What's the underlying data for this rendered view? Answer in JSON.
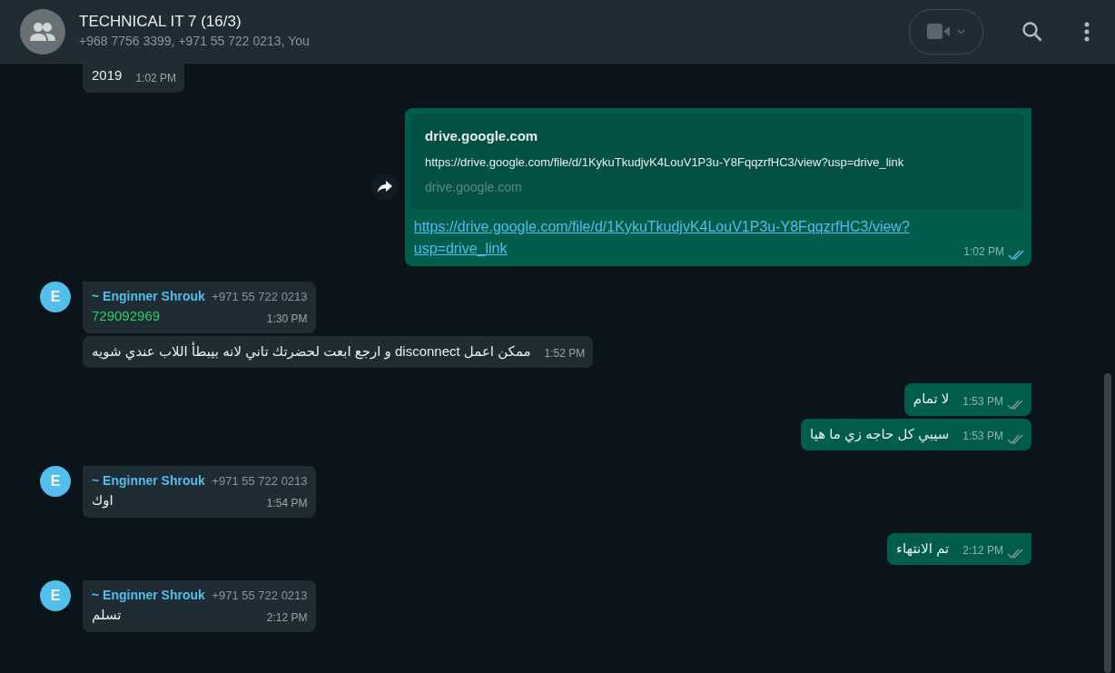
{
  "header": {
    "title": "TECHNICAL IT 7 (16/3)",
    "subtitle": "+968 7756 3399, +971 55 722 0213, You"
  },
  "messages": [
    {
      "kind": "in",
      "text": "2019",
      "time": "1:02 PM"
    },
    {
      "kind": "out",
      "preview": {
        "title": "drive.google.com",
        "url": "https://drive.google.com/file/d/1KykuTkudjvK4LouV1P3u-Y8FqqzrfHC3/view?usp=drive_link",
        "domain": "drive.google.com"
      },
      "link": "https://drive.google.com/file/d/1KykuTkudjvK4LouV1P3u-Y8FqqzrfHC3/view?usp=drive_link",
      "time": "1:02 PM",
      "read": true,
      "forwardable": true
    },
    {
      "kind": "in",
      "avatar": "E",
      "sender": "~ Enginner Shrouk",
      "phone": "+971 55 722 0213",
      "text": "729092969",
      "is_number": true,
      "time": "1:30 PM"
    },
    {
      "kind": "in",
      "text": "ممكن اعمل disconnect  و ارجع ابعت لحضرتك تاني لانه بيبطأ اللاب عندي شويه",
      "time": "1:52 PM",
      "continuation": true
    },
    {
      "kind": "out",
      "text": "لا تمام",
      "time": "1:53 PM",
      "read": false
    },
    {
      "kind": "out",
      "text": "سيبي كل حاجه زي ما هيا",
      "time": "1:53 PM",
      "read": false,
      "continuation": true
    },
    {
      "kind": "in",
      "avatar": "E",
      "sender": "~ Enginner Shrouk",
      "phone": "+971 55 722 0213",
      "text": "اوك",
      "time": "1:54 PM"
    },
    {
      "kind": "out",
      "text": "تم الانتهاء",
      "time": "2:12 PM",
      "read": false
    },
    {
      "kind": "in",
      "avatar": "E",
      "sender": "~ Enginner Shrouk",
      "phone": "+971 55 722 0213",
      "text": "تسلم",
      "time": "2:12 PM"
    }
  ]
}
